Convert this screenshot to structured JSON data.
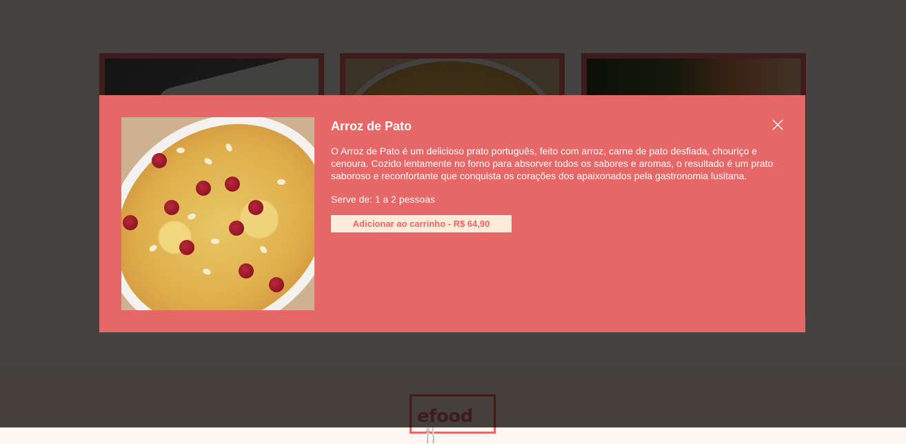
{
  "modal": {
    "title": "Arroz de Pato",
    "description": "O Arroz de Pato é um delicioso prato português, feito com arroz, carne de pato desfiada, chouriço e cenoura. Cozido lentamente no forno para absorver todos os sabores e aromas, o resultado é um prato saboroso e reconfortante que conquista os corações dos apaixonados pela gastronomia lusitana.",
    "serves": "Serve de: 1 a 2 pessoas",
    "add_button_label": "Adicionar ao carrinho - R$ 64,90",
    "close_icon": "close-icon",
    "image": "dish-photo"
  },
  "footer": {
    "logo_text": "efood"
  },
  "colors": {
    "accent": "#e66767",
    "button_bg": "#ffebd9",
    "overlay": "rgba(0,0,0,0.73)",
    "page_bg": "#fff8f2"
  }
}
